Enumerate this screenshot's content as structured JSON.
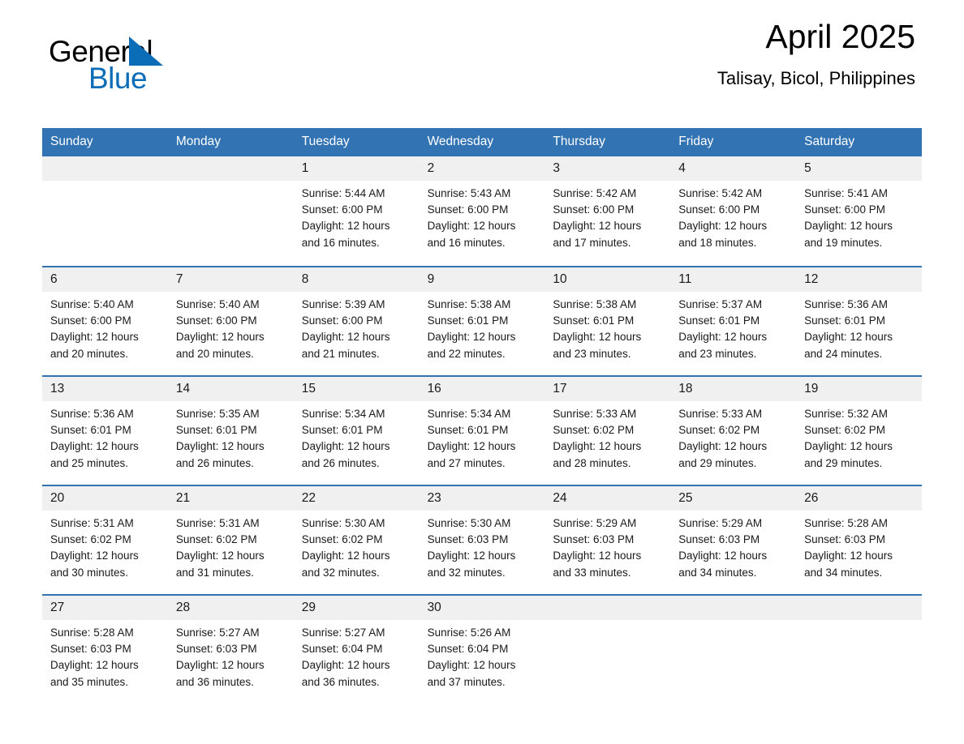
{
  "logo": {
    "word_one": "General",
    "word_two": "Blue",
    "triangle_icon": "triangle-icon",
    "brand_color": "#0b6cb7"
  },
  "header": {
    "month_title": "April 2025",
    "location": "Talisay, Bicol, Philippines",
    "header_bg_color": "#3273b3",
    "day_band_color": "#f0f0f0"
  },
  "weekdays": [
    "Sunday",
    "Monday",
    "Tuesday",
    "Wednesday",
    "Thursday",
    "Friday",
    "Saturday"
  ],
  "weeks": [
    [
      {
        "date": "",
        "empty": true,
        "sunrise": "",
        "sunset": "",
        "daylight_line1": "",
        "daylight_line2": ""
      },
      {
        "date": "",
        "empty": true,
        "sunrise": "",
        "sunset": "",
        "daylight_line1": "",
        "daylight_line2": ""
      },
      {
        "date": "1",
        "sunrise": "Sunrise: 5:44 AM",
        "sunset": "Sunset: 6:00 PM",
        "daylight_line1": "Daylight: 12 hours",
        "daylight_line2": "and 16 minutes."
      },
      {
        "date": "2",
        "sunrise": "Sunrise: 5:43 AM",
        "sunset": "Sunset: 6:00 PM",
        "daylight_line1": "Daylight: 12 hours",
        "daylight_line2": "and 16 minutes."
      },
      {
        "date": "3",
        "sunrise": "Sunrise: 5:42 AM",
        "sunset": "Sunset: 6:00 PM",
        "daylight_line1": "Daylight: 12 hours",
        "daylight_line2": "and 17 minutes."
      },
      {
        "date": "4",
        "sunrise": "Sunrise: 5:42 AM",
        "sunset": "Sunset: 6:00 PM",
        "daylight_line1": "Daylight: 12 hours",
        "daylight_line2": "and 18 minutes."
      },
      {
        "date": "5",
        "sunrise": "Sunrise: 5:41 AM",
        "sunset": "Sunset: 6:00 PM",
        "daylight_line1": "Daylight: 12 hours",
        "daylight_line2": "and 19 minutes."
      }
    ],
    [
      {
        "date": "6",
        "sunrise": "Sunrise: 5:40 AM",
        "sunset": "Sunset: 6:00 PM",
        "daylight_line1": "Daylight: 12 hours",
        "daylight_line2": "and 20 minutes."
      },
      {
        "date": "7",
        "sunrise": "Sunrise: 5:40 AM",
        "sunset": "Sunset: 6:00 PM",
        "daylight_line1": "Daylight: 12 hours",
        "daylight_line2": "and 20 minutes."
      },
      {
        "date": "8",
        "sunrise": "Sunrise: 5:39 AM",
        "sunset": "Sunset: 6:00 PM",
        "daylight_line1": "Daylight: 12 hours",
        "daylight_line2": "and 21 minutes."
      },
      {
        "date": "9",
        "sunrise": "Sunrise: 5:38 AM",
        "sunset": "Sunset: 6:01 PM",
        "daylight_line1": "Daylight: 12 hours",
        "daylight_line2": "and 22 minutes."
      },
      {
        "date": "10",
        "sunrise": "Sunrise: 5:38 AM",
        "sunset": "Sunset: 6:01 PM",
        "daylight_line1": "Daylight: 12 hours",
        "daylight_line2": "and 23 minutes."
      },
      {
        "date": "11",
        "sunrise": "Sunrise: 5:37 AM",
        "sunset": "Sunset: 6:01 PM",
        "daylight_line1": "Daylight: 12 hours",
        "daylight_line2": "and 23 minutes."
      },
      {
        "date": "12",
        "sunrise": "Sunrise: 5:36 AM",
        "sunset": "Sunset: 6:01 PM",
        "daylight_line1": "Daylight: 12 hours",
        "daylight_line2": "and 24 minutes."
      }
    ],
    [
      {
        "date": "13",
        "sunrise": "Sunrise: 5:36 AM",
        "sunset": "Sunset: 6:01 PM",
        "daylight_line1": "Daylight: 12 hours",
        "daylight_line2": "and 25 minutes."
      },
      {
        "date": "14",
        "sunrise": "Sunrise: 5:35 AM",
        "sunset": "Sunset: 6:01 PM",
        "daylight_line1": "Daylight: 12 hours",
        "daylight_line2": "and 26 minutes."
      },
      {
        "date": "15",
        "sunrise": "Sunrise: 5:34 AM",
        "sunset": "Sunset: 6:01 PM",
        "daylight_line1": "Daylight: 12 hours",
        "daylight_line2": "and 26 minutes."
      },
      {
        "date": "16",
        "sunrise": "Sunrise: 5:34 AM",
        "sunset": "Sunset: 6:01 PM",
        "daylight_line1": "Daylight: 12 hours",
        "daylight_line2": "and 27 minutes."
      },
      {
        "date": "17",
        "sunrise": "Sunrise: 5:33 AM",
        "sunset": "Sunset: 6:02 PM",
        "daylight_line1": "Daylight: 12 hours",
        "daylight_line2": "and 28 minutes."
      },
      {
        "date": "18",
        "sunrise": "Sunrise: 5:33 AM",
        "sunset": "Sunset: 6:02 PM",
        "daylight_line1": "Daylight: 12 hours",
        "daylight_line2": "and 29 minutes."
      },
      {
        "date": "19",
        "sunrise": "Sunrise: 5:32 AM",
        "sunset": "Sunset: 6:02 PM",
        "daylight_line1": "Daylight: 12 hours",
        "daylight_line2": "and 29 minutes."
      }
    ],
    [
      {
        "date": "20",
        "sunrise": "Sunrise: 5:31 AM",
        "sunset": "Sunset: 6:02 PM",
        "daylight_line1": "Daylight: 12 hours",
        "daylight_line2": "and 30 minutes."
      },
      {
        "date": "21",
        "sunrise": "Sunrise: 5:31 AM",
        "sunset": "Sunset: 6:02 PM",
        "daylight_line1": "Daylight: 12 hours",
        "daylight_line2": "and 31 minutes."
      },
      {
        "date": "22",
        "sunrise": "Sunrise: 5:30 AM",
        "sunset": "Sunset: 6:02 PM",
        "daylight_line1": "Daylight: 12 hours",
        "daylight_line2": "and 32 minutes."
      },
      {
        "date": "23",
        "sunrise": "Sunrise: 5:30 AM",
        "sunset": "Sunset: 6:03 PM",
        "daylight_line1": "Daylight: 12 hours",
        "daylight_line2": "and 32 minutes."
      },
      {
        "date": "24",
        "sunrise": "Sunrise: 5:29 AM",
        "sunset": "Sunset: 6:03 PM",
        "daylight_line1": "Daylight: 12 hours",
        "daylight_line2": "and 33 minutes."
      },
      {
        "date": "25",
        "sunrise": "Sunrise: 5:29 AM",
        "sunset": "Sunset: 6:03 PM",
        "daylight_line1": "Daylight: 12 hours",
        "daylight_line2": "and 34 minutes."
      },
      {
        "date": "26",
        "sunrise": "Sunrise: 5:28 AM",
        "sunset": "Sunset: 6:03 PM",
        "daylight_line1": "Daylight: 12 hours",
        "daylight_line2": "and 34 minutes."
      }
    ],
    [
      {
        "date": "27",
        "sunrise": "Sunrise: 5:28 AM",
        "sunset": "Sunset: 6:03 PM",
        "daylight_line1": "Daylight: 12 hours",
        "daylight_line2": "and 35 minutes."
      },
      {
        "date": "28",
        "sunrise": "Sunrise: 5:27 AM",
        "sunset": "Sunset: 6:03 PM",
        "daylight_line1": "Daylight: 12 hours",
        "daylight_line2": "and 36 minutes."
      },
      {
        "date": "29",
        "sunrise": "Sunrise: 5:27 AM",
        "sunset": "Sunset: 6:04 PM",
        "daylight_line1": "Daylight: 12 hours",
        "daylight_line2": "and 36 minutes."
      },
      {
        "date": "30",
        "sunrise": "Sunrise: 5:26 AM",
        "sunset": "Sunset: 6:04 PM",
        "daylight_line1": "Daylight: 12 hours",
        "daylight_line2": "and 37 minutes."
      },
      {
        "date": "",
        "empty": true,
        "sunrise": "",
        "sunset": "",
        "daylight_line1": "",
        "daylight_line2": ""
      },
      {
        "date": "",
        "empty": true,
        "sunrise": "",
        "sunset": "",
        "daylight_line1": "",
        "daylight_line2": ""
      },
      {
        "date": "",
        "empty": true,
        "sunrise": "",
        "sunset": "",
        "daylight_line1": "",
        "daylight_line2": ""
      }
    ]
  ]
}
